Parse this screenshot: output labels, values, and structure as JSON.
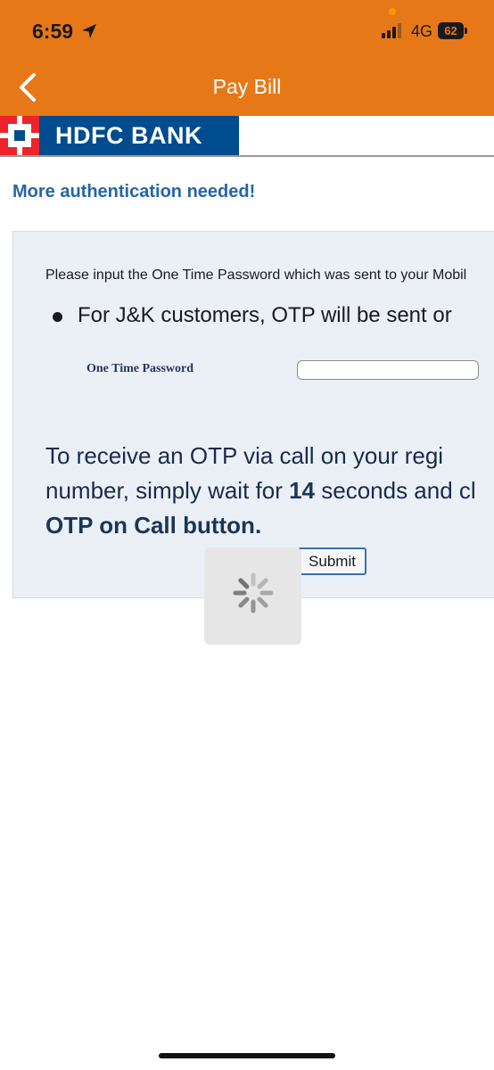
{
  "status_bar": {
    "time": "6:59",
    "network": "4G",
    "battery": "62"
  },
  "nav": {
    "title": "Pay Bill",
    "back_icon": "chevron-left-icon"
  },
  "bank": {
    "name": "HDFC BANK",
    "colors": {
      "red": "#ED232A",
      "blue": "#004C8F"
    }
  },
  "page": {
    "heading": "More authentication needed!",
    "instruction": "Please input the One Time Password which was sent to your Mobil",
    "bullet": "For J&K customers, OTP will be sent or",
    "otp_label": "One Time Password",
    "otp_value": "",
    "call_line1": "To receive an OTP via call on your regi",
    "call_line2_pre": "number, simply wait for ",
    "call_seconds": "14",
    "call_line2_post": " seconds and cl",
    "call_line3": "OTP on Call button.",
    "submit_label": "Submit"
  },
  "colors": {
    "header": "#E77817",
    "heading": "#2565A8",
    "panel": "#EBF0F7"
  },
  "loader": {
    "icon": "spinner-icon"
  }
}
